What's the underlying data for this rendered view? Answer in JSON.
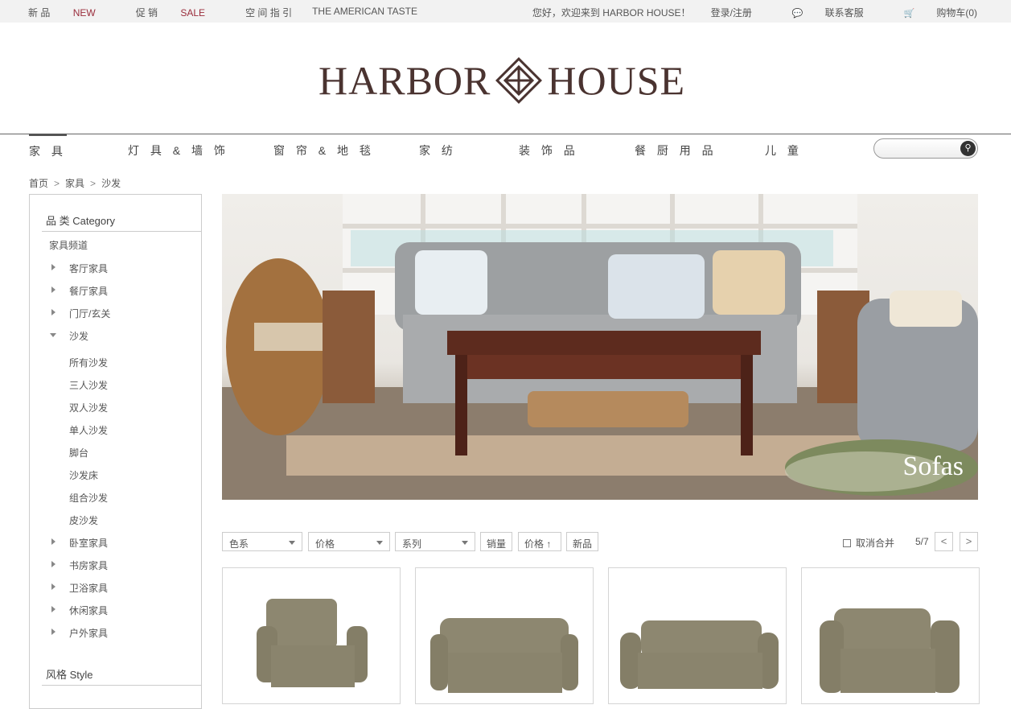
{
  "topbar": {
    "new_label": "新 品",
    "new_en": "NEW",
    "sale_label": "促 销",
    "sale_en": "SALE",
    "guide": "空 间 指 引",
    "american": "THE AMERICAN TASTE",
    "welcome": "您好，欢迎来到 HARBOR HOUSE！",
    "login": "登录/注册",
    "service": "联系客服",
    "cart": "购物车(0)"
  },
  "logo": {
    "left": "HARBOR",
    "right": "HOUSE"
  },
  "nav": {
    "items": [
      "家 具",
      "灯 具 & 墙 饰",
      "窗 帘 & 地 毯",
      "家 纺",
      "装 饰 品",
      "餐 厨 用 品",
      "儿 童"
    ]
  },
  "search": {
    "placeholder": ""
  },
  "breadcrumb": {
    "home": "首页",
    "level1": "家具",
    "level2": "沙发",
    "sep": ">"
  },
  "sidebar": {
    "category_title": "品 类 Category",
    "channel": "家具频道",
    "items": [
      "客厅家具",
      "餐厅家具",
      "门厅/玄关",
      "沙发"
    ],
    "sub_items": [
      "所有沙发",
      "三人沙发",
      "双人沙发",
      "单人沙发",
      "脚台",
      "沙发床",
      "组合沙发",
      "皮沙发"
    ],
    "items2": [
      "卧室家具",
      "书房家具",
      "卫浴家具",
      "休闲家具",
      "户外家具"
    ],
    "style_title": "风格 Style"
  },
  "hero": {
    "caption": "Sofas"
  },
  "filters": {
    "color": "色系",
    "price": "价格",
    "series": "系列",
    "sales": "销量",
    "price_sort": "价格",
    "new": "新品",
    "cancel_merge": "取消合并",
    "page": "5/7",
    "prev": "<",
    "next": ">"
  },
  "colors": {
    "accent": "#9a2d3c",
    "logo": "#4a3330",
    "sofa": "#8d8770"
  }
}
